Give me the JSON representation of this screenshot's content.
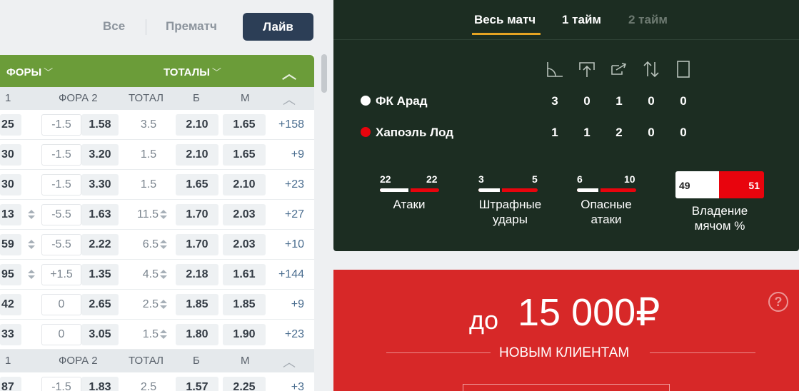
{
  "filter": {
    "all": "Все",
    "prematch": "Прематч",
    "live": "Лайв"
  },
  "group_header": {
    "handicaps": "ФОРЫ",
    "totals": "ТОТАЛЫ"
  },
  "col_headers": {
    "c0": "1",
    "hcp2": "ФОРА 2",
    "total": "ТОТАЛ",
    "over": "Б",
    "under": "М"
  },
  "rows": [
    {
      "k1": "25",
      "h2": "-1.5",
      "k2": "1.58",
      "total": "3.5",
      "over": "2.10",
      "under": "1.65",
      "more": "+158"
    },
    {
      "k1": "30",
      "h2": "-1.5",
      "k2": "3.20",
      "total": "1.5",
      "over": "2.10",
      "under": "1.65",
      "more": "+9"
    },
    {
      "k1": "30",
      "h2": "-1.5",
      "k2": "3.30",
      "total": "1.5",
      "over": "1.65",
      "under": "2.10",
      "more": "+23"
    },
    {
      "k1": "13",
      "h2": "-5.5",
      "k2": "1.63",
      "total": "11.5",
      "over": "1.70",
      "under": "2.03",
      "more": "+27"
    },
    {
      "k1": "59",
      "h2": "-5.5",
      "k2": "2.22",
      "total": "6.5",
      "over": "1.70",
      "under": "2.03",
      "more": "+10"
    },
    {
      "k1": "95",
      "h2": "+1.5",
      "k2": "1.35",
      "total": "4.5",
      "over": "2.18",
      "under": "1.61",
      "more": "+144"
    },
    {
      "k1": "42",
      "h2": "0",
      "k2": "2.65",
      "total": "2.5",
      "over": "1.85",
      "under": "1.85",
      "more": "+9"
    },
    {
      "k1": "33",
      "h2": "0",
      "k2": "3.05",
      "total": "1.5",
      "over": "1.80",
      "under": "1.90",
      "more": "+23"
    },
    {
      "k1": "87",
      "h2": "-1.5",
      "k2": "1.83",
      "total": "2.5",
      "over": "1.57",
      "under": "2.25",
      "more": "+3"
    }
  ],
  "scoreboard": {
    "tabs": {
      "full": "Весь матч",
      "first": "1 тайм",
      "second": "2 тайм"
    },
    "icons": [
      "corner-icon",
      "throw-in-icon",
      "free-kick-icon",
      "substitution-icon",
      "card-icon"
    ],
    "team1": {
      "name": "ФК Арад",
      "stats": [
        "3",
        "0",
        "1",
        "0",
        "0"
      ]
    },
    "team2": {
      "name": "Хапоэль Лод",
      "stats": [
        "1",
        "1",
        "2",
        "0",
        "0"
      ]
    },
    "attacks": {
      "label": "Атаки",
      "home": "22",
      "away": "22"
    },
    "shots": {
      "label": "Штрафные удары",
      "home": "3",
      "away": "5"
    },
    "dangerous": {
      "label": "Опасные атаки",
      "home": "6",
      "away": "10"
    },
    "possession": {
      "label": "Владение мячом %",
      "home": "49",
      "away": "51"
    },
    "colors": {
      "home": "#ffffff",
      "away": "#e8040d",
      "accent": "#e5a323"
    }
  },
  "promo": {
    "prefix": "до",
    "amount": "15 000₽",
    "subtitle": "НОВЫМ КЛИЕНТАМ",
    "help": "?"
  }
}
